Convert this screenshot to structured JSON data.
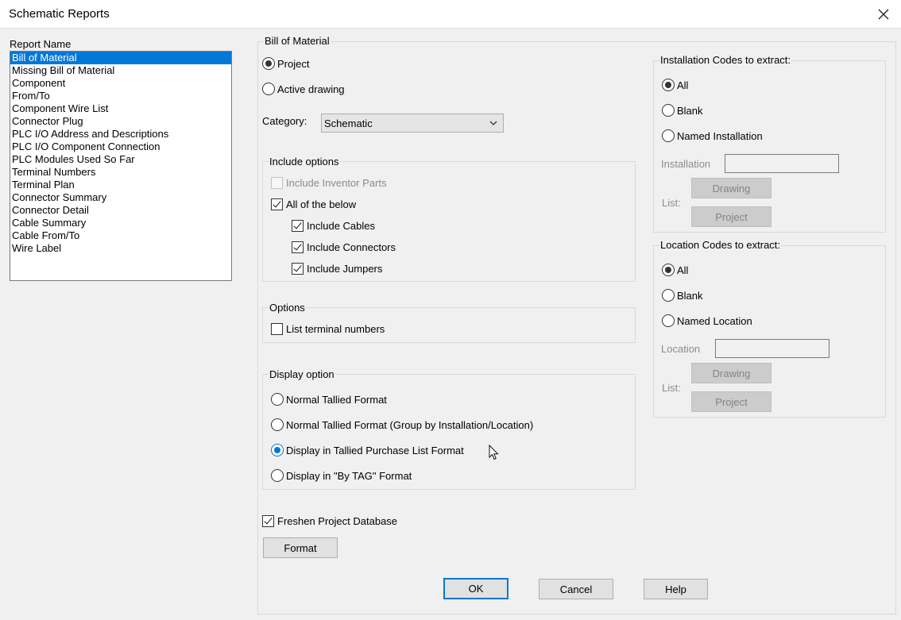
{
  "window": {
    "title": "Schematic Reports"
  },
  "report_list": {
    "label": "Report Name",
    "items": [
      "Bill of Material",
      "Missing Bill of Material",
      "Component",
      "From/To",
      "Component Wire List",
      "Connector Plug",
      "PLC I/O Address and Descriptions",
      "PLC I/O Component Connection",
      "PLC Modules Used So Far",
      "Terminal Numbers",
      "Terminal Plan",
      "Connector Summary",
      "Connector Detail",
      "Cable Summary",
      "Cable From/To",
      "Wire Label"
    ],
    "selected": "Bill of Material"
  },
  "bom": {
    "group_label": "Bill of Material",
    "scope_project": "Project",
    "scope_active": "Active drawing",
    "category_label": "Category:",
    "category_value": "Schematic"
  },
  "include_options": {
    "label": "Include options",
    "inventor": "Include Inventor Parts",
    "all_below": "All of the below",
    "cables": "Include Cables",
    "connectors": "Include Connectors",
    "jumpers": "Include Jumpers"
  },
  "options": {
    "label": "Options",
    "list_terminal": "List terminal numbers"
  },
  "display_option": {
    "label": "Display option",
    "normal": "Normal Tallied Format",
    "normal_group": "Normal Tallied Format (Group by Installation/Location)",
    "purchase": "Display in Tallied Purchase List Format",
    "by_tag": "Display in \"By TAG\" Format"
  },
  "freshen": "Freshen Project Database",
  "format_button": "Format",
  "installation": {
    "label": "Installation Codes to extract:",
    "all": "All",
    "blank": "Blank",
    "named": "Named Installation",
    "field_label": "Installation",
    "list_label": "List:",
    "drawing_button": "Drawing",
    "project_button": "Project"
  },
  "location": {
    "label": "Location Codes to extract:",
    "all": "All",
    "blank": "Blank",
    "named": "Named Location",
    "field_label": "Location",
    "list_label": "List:",
    "drawing_button": "Drawing",
    "project_button": "Project"
  },
  "buttons": {
    "ok": "OK",
    "cancel": "Cancel",
    "help": "Help"
  },
  "colors": {
    "selection": "#0078d7",
    "dialog_bg": "#f0f0f0"
  }
}
